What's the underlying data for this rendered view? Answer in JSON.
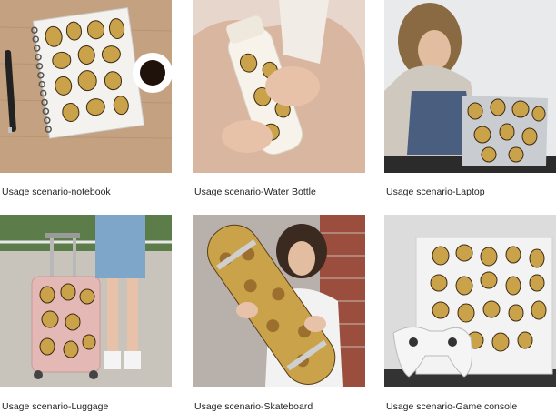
{
  "gallery": {
    "items": [
      {
        "caption": "Usage scenario-notebook"
      },
      {
        "caption": "Usage scenario-Water Bottle"
      },
      {
        "caption": "Usage scenario-Laptop"
      },
      {
        "caption": "Usage scenario-Luggage"
      },
      {
        "caption": "Usage scenario-Skateboard"
      },
      {
        "caption": "Usage scenario-Game console"
      }
    ]
  },
  "colors": {
    "sticker_gold": "#c9a24a",
    "sticker_dark": "#3b2a14",
    "wood_desk": "#c9a684",
    "skin": "#e8c2a8",
    "beige_coat": "#d9b6a0"
  }
}
